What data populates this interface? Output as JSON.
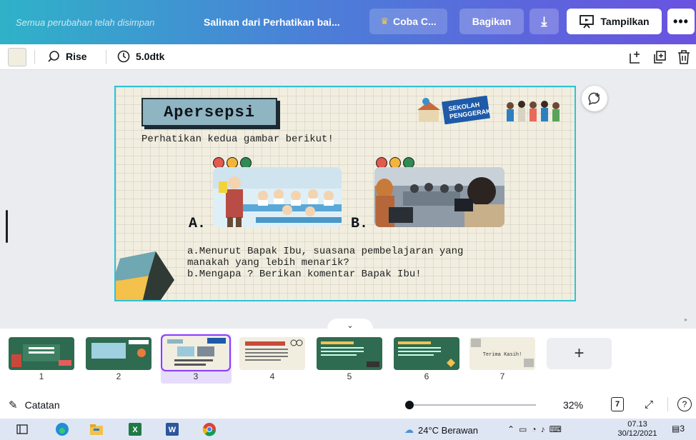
{
  "header": {
    "saved_status": "Semua perubahan telah disimpan",
    "doc_title": "Salinan dari Perhatikan bai...",
    "try_pro": "Coba C...",
    "share": "Bagikan",
    "present": "Tampilkan",
    "more": "•••"
  },
  "toolbar": {
    "animation": "Rise",
    "duration": "5.0dtk"
  },
  "slide": {
    "title": "Apersepsi",
    "intro": "Perhatikan kedua gambar berikut!",
    "label_a": "A.",
    "label_b": "B.",
    "question_a": "a.Menurut Bapak Ibu, suasana pembelajaran yang",
    "question_a2": "manakah yang lebih menarik?",
    "question_b": "b.Mengapa ? Berikan komentar Bapak Ibu!",
    "logo_text_1": "SEKOLAH",
    "logo_text_2": "PENGGERAK"
  },
  "filmstrip": {
    "pages": [
      "1",
      "2",
      "3",
      "4",
      "5",
      "6",
      "7"
    ],
    "selected": "3",
    "page7_text": "Terima Kasih!",
    "add_label": "+"
  },
  "footer": {
    "notes": "Catatan",
    "zoom": "32%",
    "page_count": "7"
  },
  "taskbar": {
    "weather": "24°C  Berawan",
    "time": "07.13",
    "date": "30/12/2021",
    "notifications": "3"
  },
  "colors": {
    "accent": "#8b3dff",
    "slide_border": "#2ec4d6",
    "slide_bg": "#f1eee0",
    "title_box": "#8fb4c2"
  }
}
